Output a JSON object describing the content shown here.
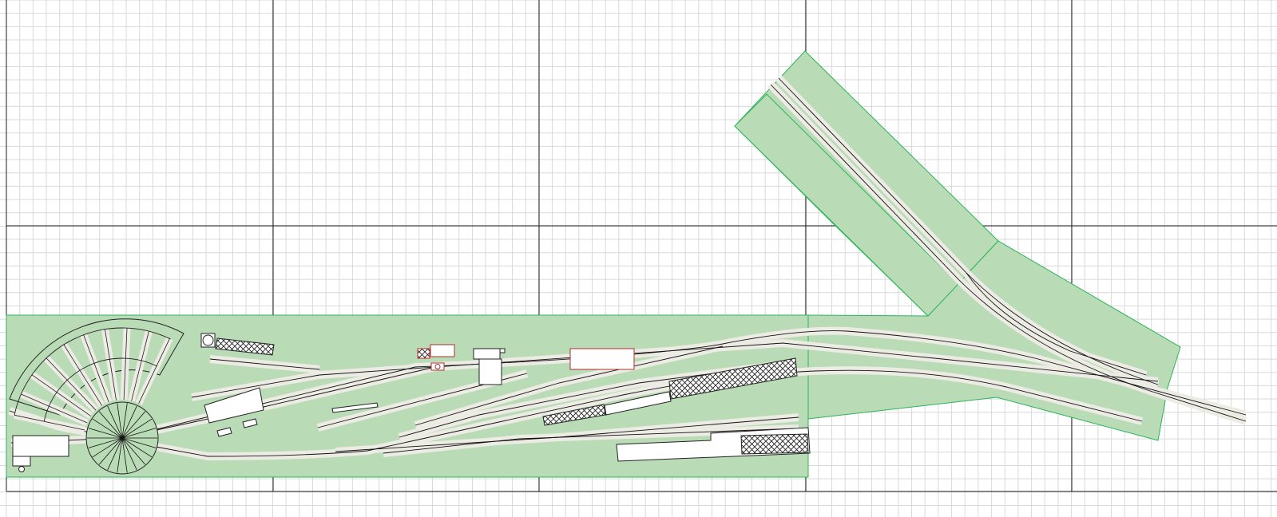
{
  "canvas": {
    "background": "#ffffff",
    "minor_grid_color": "#d9d9d9",
    "major_grid_color": "#1a1a1a"
  },
  "baseboard": {
    "fill": "#b9dbb5",
    "edge": "#2ab55a"
  },
  "track": {
    "bed_color": "#ecebe4",
    "rail_color": "#111111"
  },
  "structures": {
    "fill": "#ffffff",
    "outline": "#222222",
    "highlight": "#b03030",
    "hatched": [
      "engine-shed",
      "goods-shed",
      "warehouse",
      "platform-hatched-left",
      "loading-dock"
    ]
  },
  "turntable": {
    "present": true,
    "stall_count": 10
  },
  "icons": {
    "turntable": "turntable-icon",
    "water_tower": "water-tower-icon",
    "signal_box": "signal-box-icon"
  }
}
